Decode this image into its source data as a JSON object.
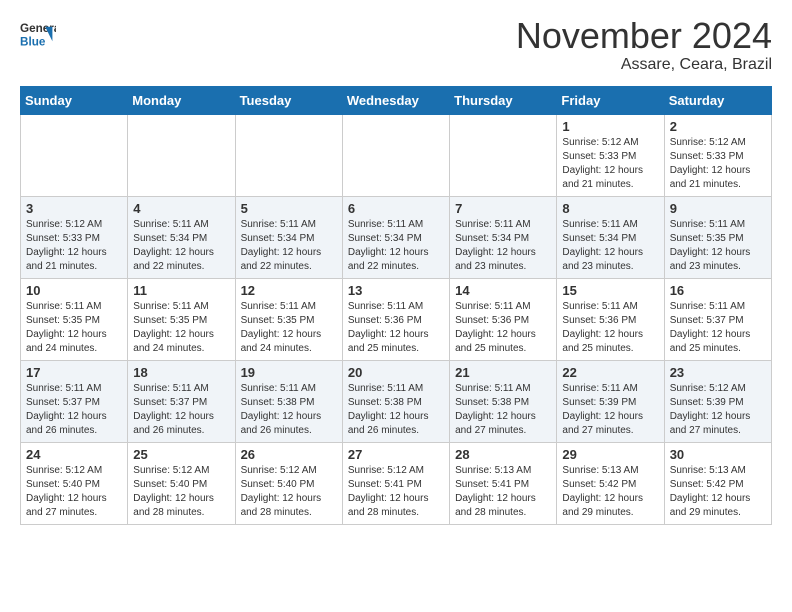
{
  "header": {
    "logo": {
      "line1": "General",
      "line2": "Blue"
    },
    "title": "November 2024",
    "location": "Assare, Ceara, Brazil"
  },
  "calendar": {
    "days_of_week": [
      "Sunday",
      "Monday",
      "Tuesday",
      "Wednesday",
      "Thursday",
      "Friday",
      "Saturday"
    ],
    "weeks": [
      [
        {
          "day": "",
          "info": ""
        },
        {
          "day": "",
          "info": ""
        },
        {
          "day": "",
          "info": ""
        },
        {
          "day": "",
          "info": ""
        },
        {
          "day": "",
          "info": ""
        },
        {
          "day": "1",
          "info": "Sunrise: 5:12 AM\nSunset: 5:33 PM\nDaylight: 12 hours\nand 21 minutes."
        },
        {
          "day": "2",
          "info": "Sunrise: 5:12 AM\nSunset: 5:33 PM\nDaylight: 12 hours\nand 21 minutes."
        }
      ],
      [
        {
          "day": "3",
          "info": "Sunrise: 5:12 AM\nSunset: 5:33 PM\nDaylight: 12 hours\nand 21 minutes."
        },
        {
          "day": "4",
          "info": "Sunrise: 5:11 AM\nSunset: 5:34 PM\nDaylight: 12 hours\nand 22 minutes."
        },
        {
          "day": "5",
          "info": "Sunrise: 5:11 AM\nSunset: 5:34 PM\nDaylight: 12 hours\nand 22 minutes."
        },
        {
          "day": "6",
          "info": "Sunrise: 5:11 AM\nSunset: 5:34 PM\nDaylight: 12 hours\nand 22 minutes."
        },
        {
          "day": "7",
          "info": "Sunrise: 5:11 AM\nSunset: 5:34 PM\nDaylight: 12 hours\nand 23 minutes."
        },
        {
          "day": "8",
          "info": "Sunrise: 5:11 AM\nSunset: 5:34 PM\nDaylight: 12 hours\nand 23 minutes."
        },
        {
          "day": "9",
          "info": "Sunrise: 5:11 AM\nSunset: 5:35 PM\nDaylight: 12 hours\nand 23 minutes."
        }
      ],
      [
        {
          "day": "10",
          "info": "Sunrise: 5:11 AM\nSunset: 5:35 PM\nDaylight: 12 hours\nand 24 minutes."
        },
        {
          "day": "11",
          "info": "Sunrise: 5:11 AM\nSunset: 5:35 PM\nDaylight: 12 hours\nand 24 minutes."
        },
        {
          "day": "12",
          "info": "Sunrise: 5:11 AM\nSunset: 5:35 PM\nDaylight: 12 hours\nand 24 minutes."
        },
        {
          "day": "13",
          "info": "Sunrise: 5:11 AM\nSunset: 5:36 PM\nDaylight: 12 hours\nand 25 minutes."
        },
        {
          "day": "14",
          "info": "Sunrise: 5:11 AM\nSunset: 5:36 PM\nDaylight: 12 hours\nand 25 minutes."
        },
        {
          "day": "15",
          "info": "Sunrise: 5:11 AM\nSunset: 5:36 PM\nDaylight: 12 hours\nand 25 minutes."
        },
        {
          "day": "16",
          "info": "Sunrise: 5:11 AM\nSunset: 5:37 PM\nDaylight: 12 hours\nand 25 minutes."
        }
      ],
      [
        {
          "day": "17",
          "info": "Sunrise: 5:11 AM\nSunset: 5:37 PM\nDaylight: 12 hours\nand 26 minutes."
        },
        {
          "day": "18",
          "info": "Sunrise: 5:11 AM\nSunset: 5:37 PM\nDaylight: 12 hours\nand 26 minutes."
        },
        {
          "day": "19",
          "info": "Sunrise: 5:11 AM\nSunset: 5:38 PM\nDaylight: 12 hours\nand 26 minutes."
        },
        {
          "day": "20",
          "info": "Sunrise: 5:11 AM\nSunset: 5:38 PM\nDaylight: 12 hours\nand 26 minutes."
        },
        {
          "day": "21",
          "info": "Sunrise: 5:11 AM\nSunset: 5:38 PM\nDaylight: 12 hours\nand 27 minutes."
        },
        {
          "day": "22",
          "info": "Sunrise: 5:11 AM\nSunset: 5:39 PM\nDaylight: 12 hours\nand 27 minutes."
        },
        {
          "day": "23",
          "info": "Sunrise: 5:12 AM\nSunset: 5:39 PM\nDaylight: 12 hours\nand 27 minutes."
        }
      ],
      [
        {
          "day": "24",
          "info": "Sunrise: 5:12 AM\nSunset: 5:40 PM\nDaylight: 12 hours\nand 27 minutes."
        },
        {
          "day": "25",
          "info": "Sunrise: 5:12 AM\nSunset: 5:40 PM\nDaylight: 12 hours\nand 28 minutes."
        },
        {
          "day": "26",
          "info": "Sunrise: 5:12 AM\nSunset: 5:40 PM\nDaylight: 12 hours\nand 28 minutes."
        },
        {
          "day": "27",
          "info": "Sunrise: 5:12 AM\nSunset: 5:41 PM\nDaylight: 12 hours\nand 28 minutes."
        },
        {
          "day": "28",
          "info": "Sunrise: 5:13 AM\nSunset: 5:41 PM\nDaylight: 12 hours\nand 28 minutes."
        },
        {
          "day": "29",
          "info": "Sunrise: 5:13 AM\nSunset: 5:42 PM\nDaylight: 12 hours\nand 29 minutes."
        },
        {
          "day": "30",
          "info": "Sunrise: 5:13 AM\nSunset: 5:42 PM\nDaylight: 12 hours\nand 29 minutes."
        }
      ]
    ]
  }
}
